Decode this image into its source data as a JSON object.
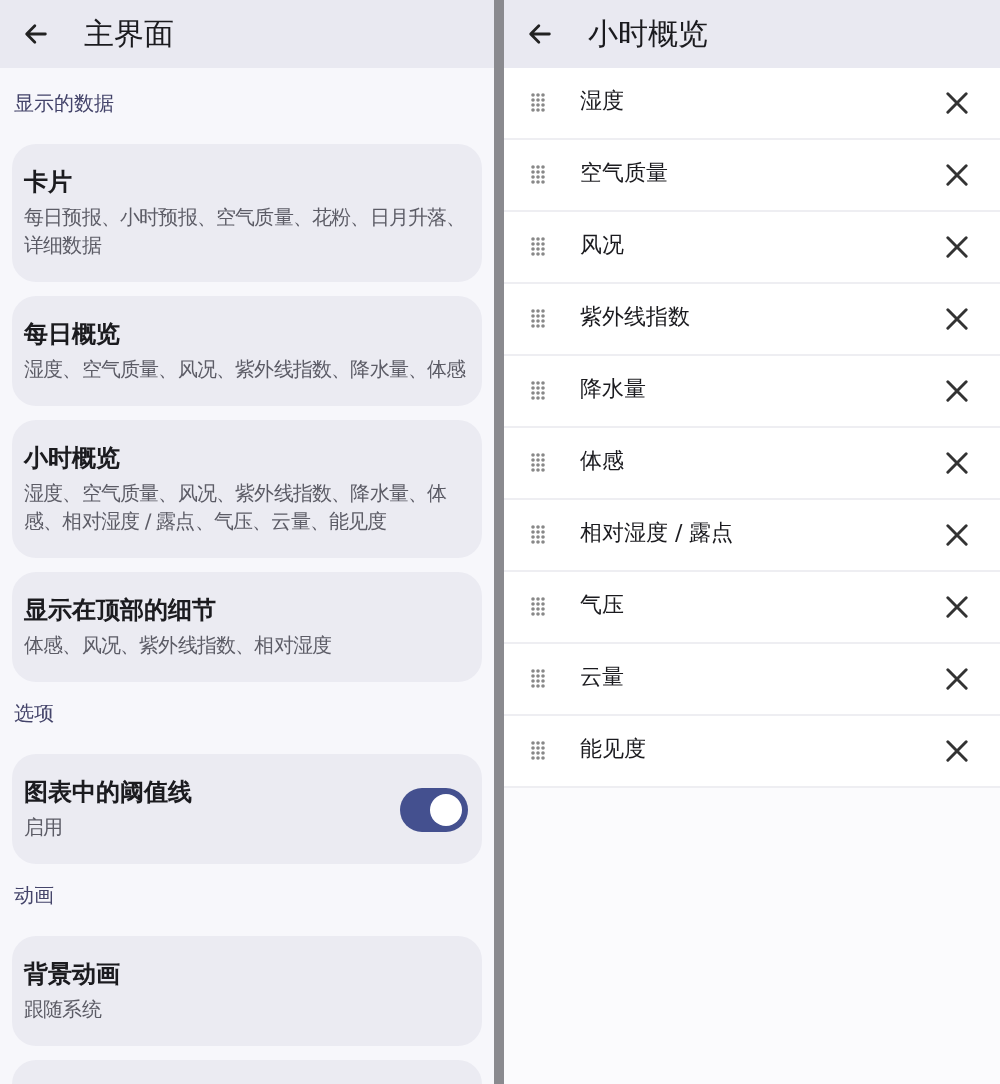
{
  "left": {
    "title": "主界面",
    "items": [
      {
        "kind": "label",
        "text": "显示的数据"
      },
      {
        "kind": "card",
        "title": "卡片",
        "subtitle": "每日预报、小时预报、空气质量、花粉、日月升落、详细数据"
      },
      {
        "kind": "card",
        "title": "每日概览",
        "subtitle": "湿度、空气质量、风况、紫外线指数、降水量、体感"
      },
      {
        "kind": "card",
        "title": "小时概览",
        "subtitle": "湿度、空气质量、风况、紫外线指数、降水量、体感、相对湿度 / 露点、气压、云量、能见度"
      },
      {
        "kind": "card",
        "title": "显示在顶部的细节",
        "subtitle": "体感、风况、紫外线指数、相对湿度"
      },
      {
        "kind": "label",
        "text": "选项"
      },
      {
        "kind": "toggle",
        "title": "图表中的阈值线",
        "subtitle": "启用",
        "on": true
      },
      {
        "kind": "label",
        "text": "动画"
      },
      {
        "kind": "card",
        "title": "背景动画",
        "subtitle": "跟随系统"
      }
    ]
  },
  "right": {
    "title": "小时概览",
    "items": [
      {
        "label": "湿度"
      },
      {
        "label": "空气质量"
      },
      {
        "label": "风况"
      },
      {
        "label": "紫外线指数"
      },
      {
        "label": "降水量"
      },
      {
        "label": "体感"
      },
      {
        "label": "相对湿度 / 露点"
      },
      {
        "label": "气压"
      },
      {
        "label": "云量"
      },
      {
        "label": "能见度"
      }
    ]
  }
}
